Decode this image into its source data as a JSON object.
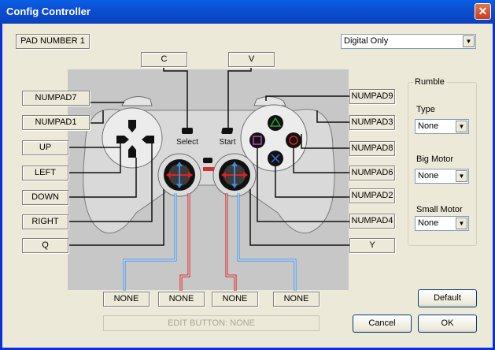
{
  "window": {
    "title": "Config Controller",
    "close_glyph": "✕"
  },
  "pad_number": "PAD NUMBER 1",
  "mode": {
    "selected": "Digital Only"
  },
  "top_keys": {
    "select": "C",
    "start": "V"
  },
  "left_keys": [
    "NUMPAD7",
    "NUMPAD1",
    "UP",
    "LEFT",
    "DOWN",
    "RIGHT",
    "Q"
  ],
  "right_keys": [
    "NUMPAD9",
    "NUMPAD3",
    "NUMPAD8",
    "NUMPAD6",
    "NUMPAD2",
    "NUMPAD4",
    "Y"
  ],
  "bottom_keys": [
    "NONE",
    "NONE",
    "NONE",
    "NONE"
  ],
  "pad_labels": {
    "select": "Select",
    "start": "Start"
  },
  "rumble": {
    "legend": "Rumble",
    "type_label": "Type",
    "type_value": "None",
    "big_label": "Big Motor",
    "big_value": "None",
    "small_label": "Small Motor",
    "small_value": "None"
  },
  "status": "EDIT BUTTON: NONE",
  "buttons": {
    "default": "Default",
    "cancel": "Cancel",
    "ok": "OK"
  },
  "colors": {
    "title_bar": "#0a5fe5",
    "pad_bg": "#c7c7c7",
    "stick_arrow_red": "#e02020",
    "stick_arrow_blue": "#3a8ee0",
    "triangle": "#2a9d3a",
    "circle": "#e02020",
    "cross": "#3a6ee0",
    "square": "#c040c0"
  }
}
